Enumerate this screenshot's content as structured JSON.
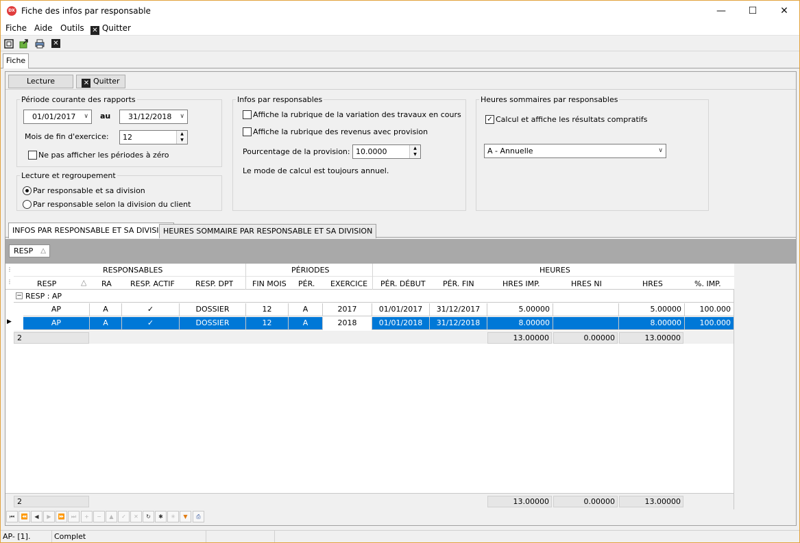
{
  "window": {
    "title": "Fiche des infos par responsable",
    "icon_label": "DX"
  },
  "menu": {
    "items": [
      "Fiche",
      "Aide",
      "Outils",
      "Quitter"
    ]
  },
  "toolbar_icons": [
    "frame-icon",
    "export-icon",
    "print-icon",
    "close-icon"
  ],
  "tabs": {
    "main": "Fiche"
  },
  "actions": {
    "lecture": "Lecture",
    "quitter": "Quitter"
  },
  "periode": {
    "legend": "Période courante des rapports",
    "from": "01/01/2017",
    "au": "au",
    "to": "31/12/2018",
    "mois_label": "Mois de fin d'exercice:",
    "mois_value": "12",
    "zero_label": "Ne pas afficher les périodes à zéro"
  },
  "lecture": {
    "legend": "Lecture et regroupement",
    "opt1": "Par responsable et sa division",
    "opt2": "Par responsable selon la division du client"
  },
  "infos": {
    "legend": "Infos par responsables",
    "chk1": "Affiche la rubrique de la variation des travaux en cours",
    "chk2": "Affiche la rubrique des revenus avec provision",
    "pct_label": "Pourcentage de la provision:",
    "pct_value": "10.0000",
    "note": "Le mode de calcul est toujours annuel."
  },
  "heures": {
    "legend": "Heures sommaires par responsables",
    "chk": "Calcul et affiche les résultats compratifs",
    "combo": "A - Annuelle"
  },
  "grid_tabs": {
    "tab1": "INFOS PAR RESPONSABLE ET SA DIVISION",
    "tab2": "HEURES SOMMAIRE PAR RESPONSABLE ET SA DIVISION"
  },
  "group_chip": "RESP",
  "bands": {
    "responsables": "RESPONSABLES",
    "periodes": "PÉRIODES",
    "heures": "HEURES"
  },
  "columns": {
    "resp": "RESP",
    "ra": "RA",
    "actif": "RESP. ACTIF",
    "dpt": "RESP. DPT",
    "finmois": "FIN MOIS",
    "per": "PÉR.",
    "exercice": "EXERCICE",
    "debut": "PÉR. DÉBUT",
    "fin": "PÉR. FIN",
    "hresimp": "HRES IMP.",
    "hresni": "HRES NI",
    "hres": "HRES",
    "pctimp": "%. IMP."
  },
  "group_row": "RESP : AP",
  "rows": [
    {
      "resp": "AP",
      "ra": "A",
      "actif": "✓",
      "dpt": "DOSSIER",
      "finmois": "12",
      "per": "A",
      "exercice": "2017",
      "debut": "01/01/2017",
      "fin": "31/12/2017",
      "hresimp": "5.00000",
      "hresni": "",
      "hres": "5.00000",
      "pctimp": "100.000"
    },
    {
      "resp": "AP",
      "ra": "A",
      "actif": "✓",
      "dpt": "DOSSIER",
      "finmois": "12",
      "per": "A",
      "exercice": "2018",
      "debut": "01/01/2018",
      "fin": "31/12/2018",
      "hresimp": "8.00000",
      "hresni": "",
      "hres": "8.00000",
      "pctimp": "100.000"
    }
  ],
  "group_footer": {
    "count": "2",
    "hresimp": "13.00000",
    "hresni": "0.00000",
    "hres": "13.00000"
  },
  "grid_footer": {
    "count": "2",
    "hresimp": "13.00000",
    "hresni": "0.00000",
    "hres": "13.00000"
  },
  "status": {
    "left": "AP- [1].",
    "state": "Complet"
  }
}
